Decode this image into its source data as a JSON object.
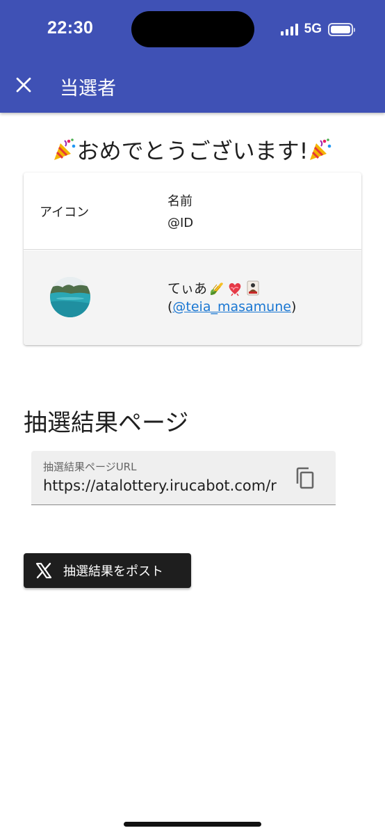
{
  "status_bar": {
    "time": "22:30",
    "network": "5G",
    "signal_bars": 4,
    "battery_level": 1.0
  },
  "appbar": {
    "title": "当選者",
    "close_icon": "close-icon",
    "background_color": "#3f51b5"
  },
  "congrats": {
    "party_icon": "party-popper-icon",
    "text": "おめでとうございます!"
  },
  "winner_table": {
    "headers": {
      "icon": "アイコン",
      "name": "名前",
      "id": "@ID"
    },
    "rows": [
      {
        "avatar_icon": "lake-photo-avatar",
        "name": "てぃあ",
        "name_emojis": [
          "corn-icon",
          "heart-icon",
          "card-icon"
        ],
        "id_prefix": "(",
        "id_link": "@teia_masamune",
        "id_suffix": ")"
      }
    ]
  },
  "result_page": {
    "heading": "抽選結果ページ",
    "url_label": "抽選結果ページURL",
    "url_value": "https://atalottery.irucabot.com/re",
    "copy_icon": "copy-icon"
  },
  "post_button": {
    "icon": "x-logo-icon",
    "label": "抽選結果をポスト"
  },
  "colors": {
    "accent": "#3f51b5",
    "link": "#1976d2",
    "post_button_bg": "#1e1e1e"
  }
}
